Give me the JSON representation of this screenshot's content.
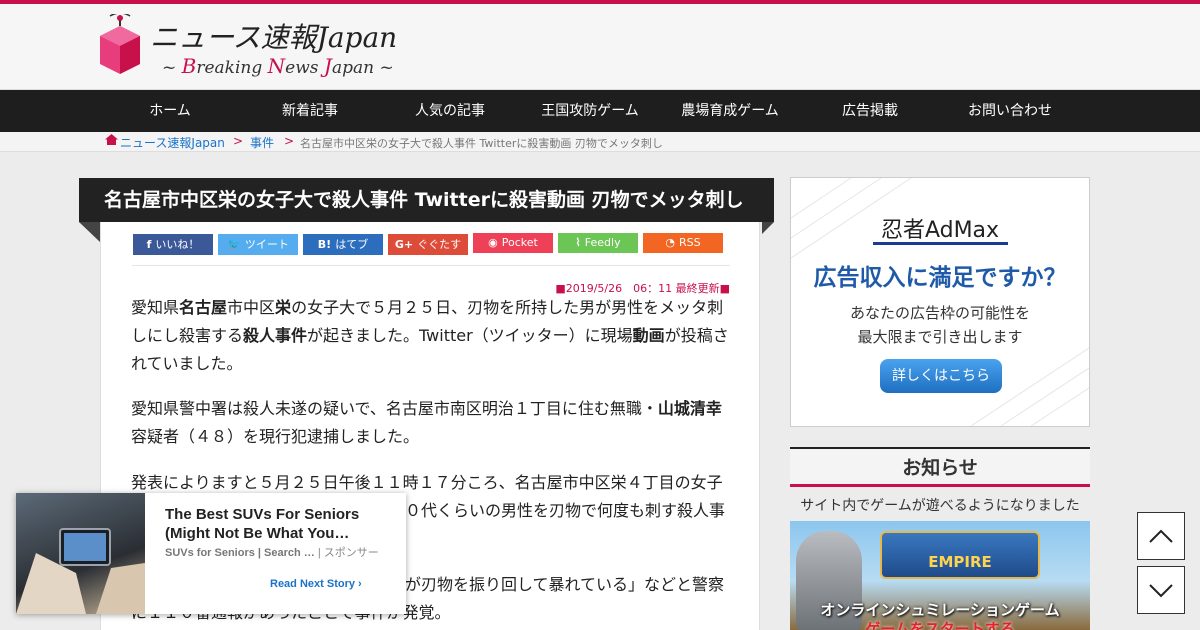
{
  "site": {
    "logo_letters": [
      "B",
      "N",
      "J"
    ],
    "title": "ニュース速報Japan",
    "subtitle_parts": [
      "~ ",
      "B",
      "reaking ",
      "N",
      "ews ",
      "J",
      "apan ~"
    ]
  },
  "nav": [
    "ホーム",
    "新着記事",
    "人気の記事",
    "王国攻防ゲーム",
    "農場育成ゲーム",
    "広告掲載",
    "お問い合わせ"
  ],
  "breadcrumb": {
    "home": "ニュース速報Japan",
    "sep": ">",
    "category": "事件",
    "current": "名古屋市中区栄の女子大で殺人事件 Twitterに殺害動画 刃物でメッタ刺し"
  },
  "article": {
    "title": "名古屋市中区栄の女子大で殺人事件 Twitterに殺害動画 刃物でメッタ刺し",
    "share": [
      {
        "icon": "f",
        "label": "いいね！",
        "color": "#3b5998"
      },
      {
        "icon": "🐦",
        "label": "ツイート",
        "color": "#55acee"
      },
      {
        "icon": "B!",
        "label": "はてブ",
        "color": "#2c6ebd"
      },
      {
        "icon": "G+",
        "label": "ぐぐたす",
        "color": "#dd4b39"
      },
      {
        "icon": "◉",
        "label": "Pocket",
        "color": "#ee4056"
      },
      {
        "icon": "⌇",
        "label": "Feedly",
        "color": "#6cc655"
      },
      {
        "icon": "◔",
        "label": "RSS",
        "color": "#f26522"
      }
    ],
    "updated": "■2019/5/26　06：11 最終更新■",
    "p1": [
      "愛知県",
      "名古屋",
      "市中区",
      "栄",
      "の女子大で５月２５日、刃物を所持した男が男性をメッタ刺しにし殺害する",
      "殺人事件",
      "が起きました。Twitter（ツイッター）に現場",
      "動画",
      "が投稿されていました。"
    ],
    "p2": [
      "愛知県警中署は殺人未遂の疑いで、名古屋市南区明治１丁目に住む無職・",
      "山城清幸",
      "容疑者（４８）を現行犯逮捕しました。"
    ],
    "p3": "発表によりますと５月２５日午後１１時１７分ころ、名古屋市中区栄４丁目の女子",
    "p3b": "０代くらいの男性を刃物で何度も刺す殺人事",
    "p4a": "が刃物を振り回して暴れている」などと警察",
    "p4b": "に１１０番通報があったことで事件が発覚。"
  },
  "sidebar": {
    "ad": {
      "brand": "忍者AdMax",
      "headline": "広告収入に満足ですか？",
      "copy1": "あなたの広告枠の可能性を",
      "copy2": "最大限まで引き出します",
      "button": "詳しくはこちら"
    },
    "notice": {
      "heading": "お知らせ",
      "text": "サイト内でゲームが遊べるようになりました",
      "banner_logo": "EMPIRE",
      "banner_text1": "オンラインシュミレーションゲーム",
      "banner_text2": "ゲームをスタートする"
    }
  },
  "popup": {
    "title": "The Best SUVs For Seniors (Might Not Be What You…",
    "source": "SUVs for Seniors | Search …",
    "sponsor": "| スポンサー",
    "read_next": "Read Next Story"
  }
}
